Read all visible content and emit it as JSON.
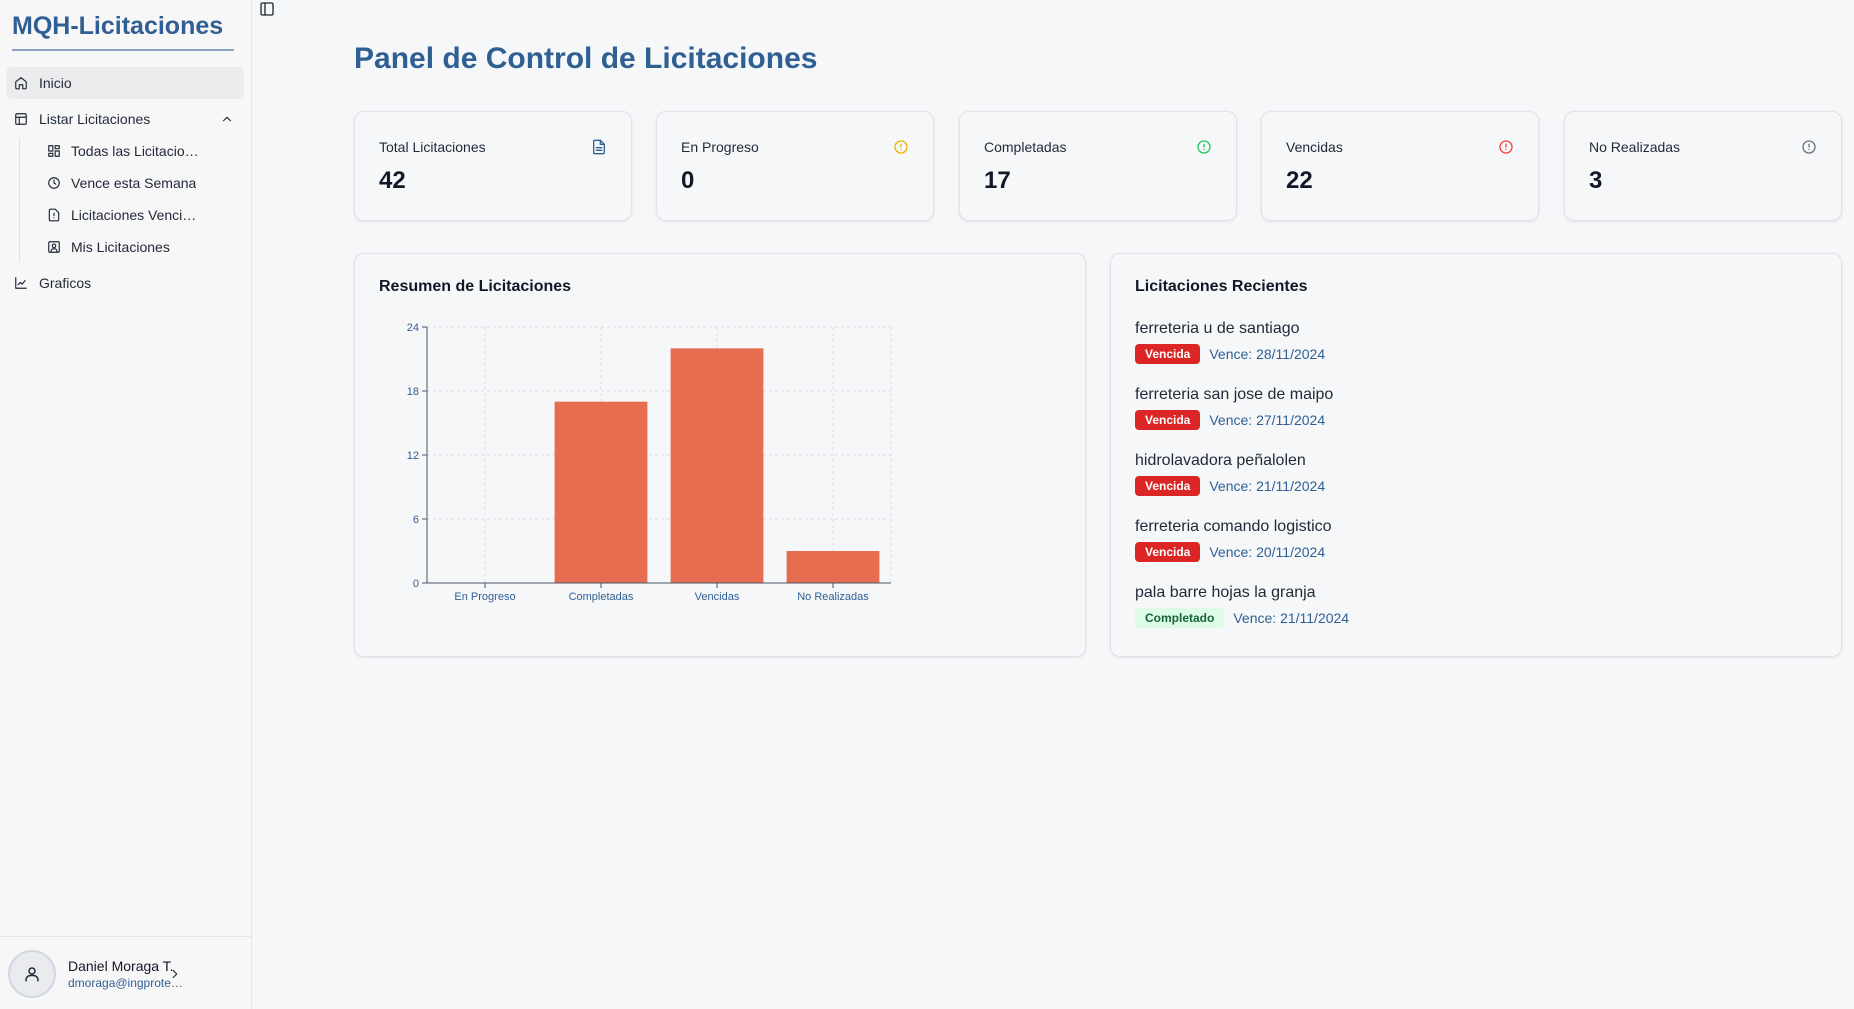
{
  "app": {
    "brand": "MQH-Licitaciones"
  },
  "sidebar": {
    "items": [
      {
        "label": "Inicio",
        "icon": "home-icon"
      },
      {
        "label": "Listar Licitaciones",
        "icon": "table-icon"
      },
      {
        "label": "Graficos",
        "icon": "line-chart-icon"
      }
    ],
    "subitems": [
      {
        "label": "Todas las Licitaciones",
        "icon": "grid-icon"
      },
      {
        "label": "Vence esta Semana",
        "icon": "clock-icon"
      },
      {
        "label": "Licitaciones Vencidas",
        "icon": "file-alert-icon"
      },
      {
        "label": "Mis Licitaciones",
        "icon": "user-square-icon"
      }
    ],
    "user": {
      "name": "Daniel Moraga T.",
      "email": "dmoraga@ingprotec.cl"
    }
  },
  "main": {
    "title": "Panel de Control de Licitaciones",
    "stats": [
      {
        "label": "Total Licitaciones",
        "value": "42",
        "icon": "file-text-icon",
        "color": "#2f5f93"
      },
      {
        "label": "En Progreso",
        "value": "0",
        "icon": "alert-circle-icon",
        "color": "#eab308"
      },
      {
        "label": "Completadas",
        "value": "17",
        "icon": "alert-circle-icon",
        "color": "#22c55e"
      },
      {
        "label": "Vencidas",
        "value": "22",
        "icon": "alert-circle-icon",
        "color": "#ef4444"
      },
      {
        "label": "No Realizadas",
        "value": "3",
        "icon": "alert-circle-icon",
        "color": "#6b7280"
      }
    ],
    "summary_title": "Resumen de Licitaciones",
    "recent": {
      "title": "Licitaciones Recientes",
      "due_prefix": "Vence:",
      "items": [
        {
          "name": "ferreteria u de santiago",
          "status": "Vencida",
          "due": "28/11/2024"
        },
        {
          "name": "ferreteria san jose de maipo",
          "status": "Vencida",
          "due": "27/11/2024"
        },
        {
          "name": "hidrolavadora peñalolen",
          "status": "Vencida",
          "due": "21/11/2024"
        },
        {
          "name": "ferreteria comando logistico",
          "status": "Vencida",
          "due": "20/11/2024"
        },
        {
          "name": "pala barre hojas la granja",
          "status": "Completado",
          "due": "21/11/2024"
        }
      ]
    }
  },
  "colors": {
    "accent": "#2f5f93",
    "bar": "#e76d51",
    "danger": "#dc2626"
  },
  "chart_data": {
    "type": "bar",
    "categories": [
      "En Progreso",
      "Completadas",
      "Vencidas",
      "No Realizadas"
    ],
    "values": [
      0,
      17,
      22,
      3
    ],
    "title": "Resumen de Licitaciones",
    "xlabel": "",
    "ylabel": "",
    "ylim": [
      0,
      24
    ],
    "yticks": [
      0,
      6,
      12,
      18,
      24
    ],
    "grid": true
  }
}
